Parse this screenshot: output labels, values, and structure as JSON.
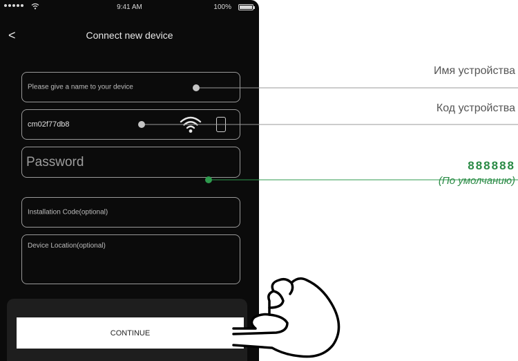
{
  "status_bar": {
    "time": "9:41 AM",
    "battery": "100%"
  },
  "nav": {
    "title": "Connect new device",
    "back_label": "<"
  },
  "fields": {
    "device_name": {
      "placeholder": "Please give a name to your device"
    },
    "device_code": {
      "value": "cm02f77db8"
    },
    "password": {
      "placeholder": "Password"
    },
    "installation_code": {
      "placeholder": "Installation Code(optional)"
    },
    "device_location": {
      "placeholder": "Device Location(optional)"
    }
  },
  "continue_label": "CONTINUE",
  "annotations": {
    "device_name": "Имя устройства",
    "device_code": "Код устройства",
    "default_password": "888888",
    "default_note": "(По умолчанию)"
  },
  "colors": {
    "annotation_green": "#2e9a4e",
    "annotation_gray": "#c4c4c4",
    "phone_background": "#0b0b0b"
  },
  "icons": [
    "wifi-icon",
    "phone-icon",
    "pointing-hand-icon",
    "back-chevron-icon",
    "battery-icon",
    "signal-dots-icon"
  ]
}
